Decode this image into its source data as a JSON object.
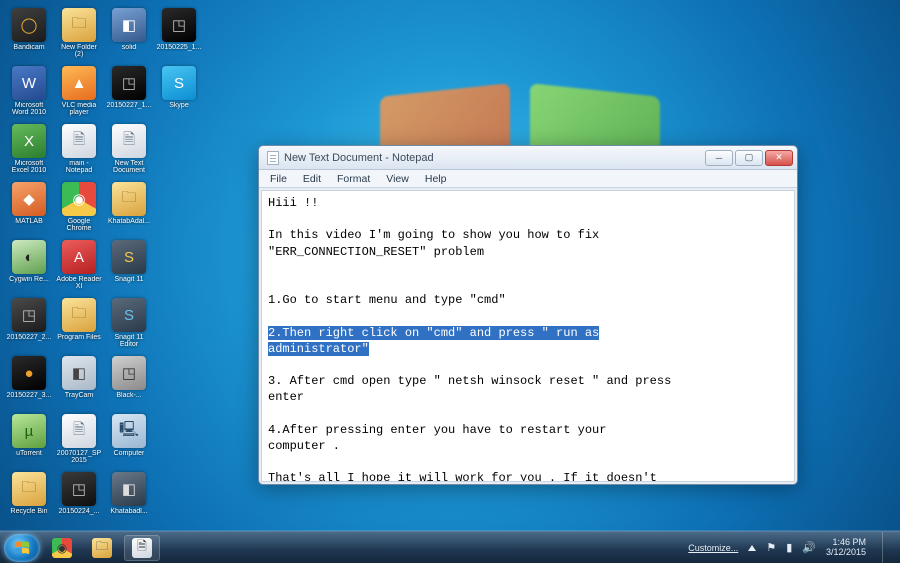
{
  "desktop_icons": [
    [
      {
        "label": "Bandicam",
        "glyph": "◯",
        "bg": "linear-gradient(160deg,#3f3f3f,#1b1b1b)",
        "fg": "#f0b030"
      },
      {
        "label": "New Folder (2)",
        "glyph": "🗀",
        "bg": "linear-gradient(160deg,#fbe39a,#d9a23c)",
        "fg": "#8a5a12"
      },
      {
        "label": "solid",
        "glyph": "◧",
        "bg": "linear-gradient(160deg,#7aa1d4,#34598c)",
        "fg": "#fff"
      },
      {
        "label": "20150225_1...",
        "glyph": "◳",
        "bg": "linear-gradient(160deg,#2a2a2a,#000)",
        "fg": "#bbb"
      }
    ],
    [
      {
        "label": "Microsoft Word 2010",
        "glyph": "W",
        "bg": "linear-gradient(160deg,#4a79c7,#244a8f)",
        "fg": "#fff"
      },
      {
        "label": "VLC media player",
        "glyph": "▲",
        "bg": "linear-gradient(160deg,#ffb957,#e76c1e)",
        "fg": "#fff"
      },
      {
        "label": "20150227_1...",
        "glyph": "◳",
        "bg": "linear-gradient(160deg,#2a2a2a,#000)",
        "fg": "#bbb"
      },
      {
        "label": "Skype",
        "glyph": "S",
        "bg": "linear-gradient(160deg,#49c4f2,#0b8fd4)",
        "fg": "#fff"
      }
    ],
    [
      {
        "label": "Microsoft Excel 2010",
        "glyph": "X",
        "bg": "linear-gradient(160deg,#67bb5b,#2a7d2f)",
        "fg": "#fff"
      },
      {
        "label": "main - Notepad",
        "glyph": "🗎",
        "bg": "linear-gradient(160deg,#fefefe,#cfd6e0)",
        "fg": "#6a7b8d"
      },
      {
        "label": "New Text Document",
        "glyph": "🗎",
        "bg": "linear-gradient(160deg,#fefefe,#cfd6e0)",
        "fg": "#6a7b8d"
      }
    ],
    [
      {
        "label": "MATLAB",
        "glyph": "◆",
        "bg": "linear-gradient(160deg,#f6a36a,#d55b21)",
        "fg": "#fff"
      },
      {
        "label": "Google Chrome",
        "glyph": "◉",
        "bg": "conic-gradient(#e74a3c 0 120deg,#f7c948 120deg 240deg,#3cba54 240deg 360deg)",
        "fg": "#fff"
      },
      {
        "label": "KhatabAdal...",
        "glyph": "🗀",
        "bg": "linear-gradient(160deg,#fbe39a,#d9a23c)",
        "fg": "#8a5a12"
      }
    ],
    [
      {
        "label": "Cygwin Re...",
        "glyph": "◐",
        "bg": "linear-gradient(160deg,#cdeac0,#5fa04f)",
        "fg": "#222"
      },
      {
        "label": "Adobe Reader XI",
        "glyph": "A",
        "bg": "linear-gradient(160deg,#ee5c5c,#b51f1f)",
        "fg": "#fff"
      },
      {
        "label": "Snagit 11",
        "glyph": "S",
        "bg": "linear-gradient(160deg,#5a6a7a,#2a3a4a)",
        "fg": "#f7c948"
      }
    ],
    [
      {
        "label": "20150227_2...",
        "glyph": "◳",
        "bg": "linear-gradient(160deg,#4a4a4a,#1b1b1b)",
        "fg": "#bbb"
      },
      {
        "label": "Program Files",
        "glyph": "🗀",
        "bg": "linear-gradient(160deg,#fbe39a,#d9a23c)",
        "fg": "#8a5a12"
      },
      {
        "label": "Snagit 11 Editor",
        "glyph": "S",
        "bg": "linear-gradient(160deg,#5a6a7a,#2a3a4a)",
        "fg": "#6ec0f0"
      }
    ],
    [
      {
        "label": "20150227_3...",
        "glyph": "●",
        "bg": "linear-gradient(160deg,#2a2a2a,#000)",
        "fg": "#f0a030"
      },
      {
        "label": "TrayCam",
        "glyph": "◧",
        "bg": "linear-gradient(160deg,#dfe6ee,#aab8c8)",
        "fg": "#444"
      },
      {
        "label": "Black-...",
        "glyph": "◳",
        "bg": "linear-gradient(160deg,#d0d0d0,#8a8a8a)",
        "fg": "#333"
      }
    ],
    [
      {
        "label": "uTorrent",
        "glyph": "µ",
        "bg": "linear-gradient(160deg,#b7e79a,#5fa03f)",
        "fg": "#1f5f10"
      },
      {
        "label": "20070127_SP2015",
        "glyph": "🗎",
        "bg": "linear-gradient(160deg,#fefefe,#cfd6e0)",
        "fg": "#6a7b8d"
      },
      {
        "label": "Computer",
        "glyph": "🖳",
        "bg": "linear-gradient(160deg,#d7e6f4,#9ab6d2)",
        "fg": "#2a4a6a"
      }
    ],
    [
      {
        "label": "Recycle Bin",
        "glyph": "🗀",
        "bg": "linear-gradient(160deg,#fbe39a,#d9a23c)",
        "fg": "#8a5a12"
      },
      {
        "label": "20150224_...",
        "glyph": "◳",
        "bg": "linear-gradient(160deg,#3a3a3a,#0f0f0f)",
        "fg": "#bbb"
      },
      {
        "label": "Khatabadl...",
        "glyph": "◧",
        "bg": "linear-gradient(160deg,#6a7a8a,#2a3a4a)",
        "fg": "#ddd"
      }
    ]
  ],
  "notepad": {
    "title": "New Text Document - Notepad",
    "menu": [
      "File",
      "Edit",
      "Format",
      "View",
      "Help"
    ],
    "lines_pre": "Hiii !!\n\nIn this video I'm going to show you how to fix\n\"ERR_CONNECTION_RESET\" problem\n\n\n1.Go to start menu and type \"cmd\"\n\n",
    "lines_sel": "2.Then right click on \"cmd\" and press \" run as\nadministrator\"",
    "lines_post": "\n\n3. After cmd open type \" netsh winsock reset \" and press\nenter\n\n4.After pressing enter you have to restart your\ncomputer .\n\nThat's all I hope it will work for you . If it doesn't\nwork only unistall google chrome and install it again.\n\nPLS SUBSCRIBE"
  },
  "taskbar": {
    "pinned": [
      {
        "name": "chrome-icon",
        "bg": "conic-gradient(#e74a3c 0 120deg,#f7c948 120deg 240deg,#3cba54 240deg 360deg)",
        "glyph": "◉"
      },
      {
        "name": "explorer-icon",
        "bg": "linear-gradient(160deg,#fbe39a,#d9a23c)",
        "glyph": "🗀"
      },
      {
        "name": "notepad-app-icon",
        "bg": "linear-gradient(160deg,#fefefe,#cfd6e0)",
        "glyph": "🗎",
        "active": true
      }
    ],
    "tray_label": "Customize...",
    "time": "1:46 PM",
    "date": "3/12/2015"
  }
}
